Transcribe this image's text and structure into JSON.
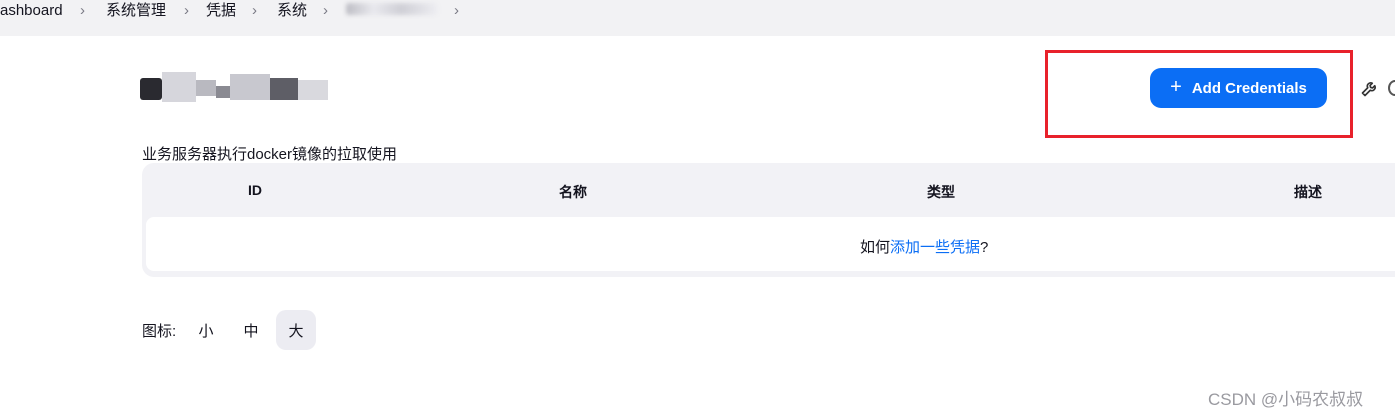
{
  "breadcrumb": {
    "items": [
      "ashboard",
      "系统管理",
      "凭据",
      "系统"
    ],
    "separator": "›"
  },
  "header": {
    "add_credentials_label": "Add Credentials",
    "accent_color": "#0b6ef5"
  },
  "store": {
    "description": "业务服务器执行docker镜像的拉取使用"
  },
  "table": {
    "columns": [
      "ID",
      "名称",
      "类型",
      "描述"
    ],
    "empty_prefix": "如何",
    "empty_link": "添加一些凭据",
    "empty_suffix": "?"
  },
  "icon_size": {
    "label": "图标:",
    "options": [
      "小",
      "中",
      "大"
    ],
    "selected": "大"
  },
  "watermark": "CSDN @小码农叔叔",
  "icons": {
    "add": "plus-icon",
    "configure": "wrench-icon"
  }
}
